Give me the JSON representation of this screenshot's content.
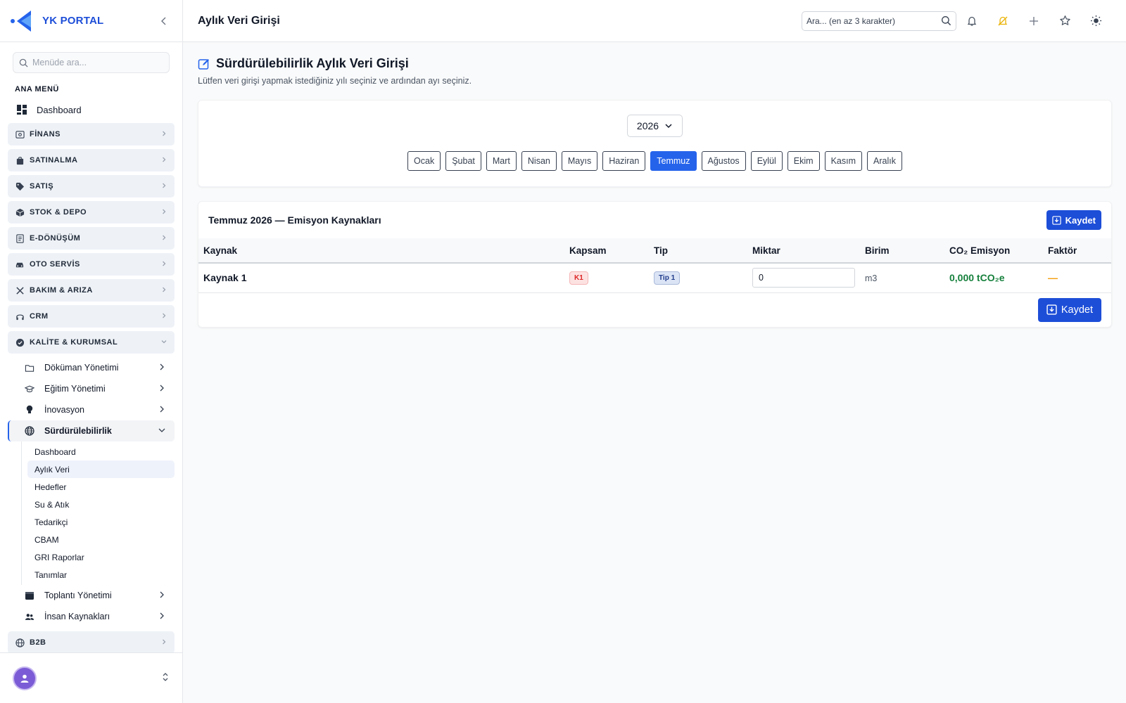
{
  "brand": {
    "name": "YK PORTAL",
    "accent": "#2563eb"
  },
  "sidebar": {
    "search_placeholder": "Menüde ara...",
    "section_title": "ANA MENÜ",
    "dashboard_label": "Dashboard",
    "groups_top": [
      {
        "label": "FİNANS",
        "icon": "finance-icon"
      },
      {
        "label": "SATINALMA",
        "icon": "bag-icon"
      },
      {
        "label": "SATIŞ",
        "icon": "tag-icon"
      },
      {
        "label": "STOK & DEPO",
        "icon": "box-icon"
      },
      {
        "label": "E-DÖNÜŞÜM",
        "icon": "document-icon"
      },
      {
        "label": "OTO SERVİS",
        "icon": "car-icon"
      },
      {
        "label": "BAKIM & ARIZA",
        "icon": "tools-icon"
      },
      {
        "label": "CRM",
        "icon": "headset-icon"
      }
    ],
    "open_group": {
      "label": "KALİTE & KURUMSAL",
      "icon": "shield-check-icon"
    },
    "sub_items_before": [
      {
        "label": "Döküman Yönetimi",
        "icon": "folder-icon"
      },
      {
        "label": "Eğitim Yönetimi",
        "icon": "graduation-cap-icon"
      },
      {
        "label": "İnovasyon",
        "icon": "lightbulb-icon"
      }
    ],
    "active_sub": {
      "label": "Sürdürülebilirlik",
      "icon": "globe-icon"
    },
    "leaves": [
      "Dashboard",
      "Aylık Veri",
      "Hedefler",
      "Su & Atık",
      "Tedarikçi",
      "CBAM",
      "GRI Raporlar",
      "Tanımlar"
    ],
    "active_leaf_index": 1,
    "sub_items_after": [
      {
        "label": "Toplantı Yönetimi",
        "icon": "calendar-icon"
      },
      {
        "label": "İnsan Kaynakları",
        "icon": "users-icon"
      }
    ],
    "group_bottom": {
      "label": "B2B",
      "icon": "globe-icon"
    }
  },
  "topbar": {
    "title": "Aylık Veri Girişi",
    "search_placeholder": "Ara... (en az 3 karakter)"
  },
  "main": {
    "title": "Sürdürülebilirlik Aylık Veri Girişi",
    "subtitle": "Lütfen veri girişi yapmak istediğiniz yılı seçiniz ve ardından ayı seçiniz.",
    "year": "2026",
    "months": [
      "Ocak",
      "Şubat",
      "Mart",
      "Nisan",
      "Mayıs",
      "Haziran",
      "Temmuz",
      "Ağustos",
      "Eylül",
      "Ekim",
      "Kasım",
      "Aralık"
    ],
    "active_month_index": 6,
    "table": {
      "title": "Temmuz 2026 — Emisyon Kaynakları",
      "save_label": "Kaydet",
      "columns": [
        "Kaynak",
        "Kapsam",
        "Tip",
        "Miktar",
        "Birim",
        "CO₂ Emisyon",
        "Faktör"
      ],
      "rows": [
        {
          "source": "Kaynak 1",
          "scope": "K1",
          "type": "Tip 1",
          "quantity": "0",
          "unit": "m3",
          "emission": "0,000 tCO₂e",
          "factor": "—"
        }
      ],
      "footer_save_label": "Kaydet"
    }
  }
}
